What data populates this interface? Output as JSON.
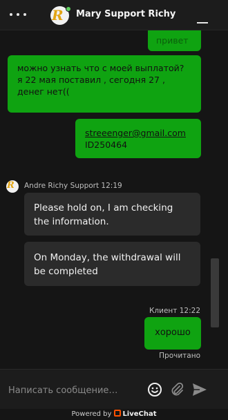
{
  "header": {
    "title": "Mary Support Richy",
    "avatar_letter": "R",
    "online_color": "#5fd15f"
  },
  "messages": {
    "m1": "привет",
    "m2": "можно узнать что с моей выплатой? я 22 мая поставил , сегодня 27 , денег нет((",
    "m3_email": "streeenger@gmail.com",
    "m3_id": "ID250464",
    "agent_meta": "Andre Richy Support 12:19",
    "m4": "Please hold on, I am checking the information.",
    "m5": "On Monday, the withdrawal will be completed",
    "client_meta": "Клиент 12:22",
    "m6": "хорошо",
    "read_status": "Прочитано"
  },
  "composer": {
    "placeholder": "Написать сообщение…"
  },
  "footer": {
    "powered_by": "Powered by",
    "brand": "LiveChat"
  },
  "colors": {
    "client_bubble": "#0fa311",
    "agent_bubble": "#2b2b2b",
    "background": "#151515",
    "brand": "#ff5100"
  },
  "icons": [
    "menu-dots-icon",
    "minimize-icon",
    "emoji-icon",
    "paperclip-icon",
    "send-icon",
    "livechat-logo-icon"
  ]
}
